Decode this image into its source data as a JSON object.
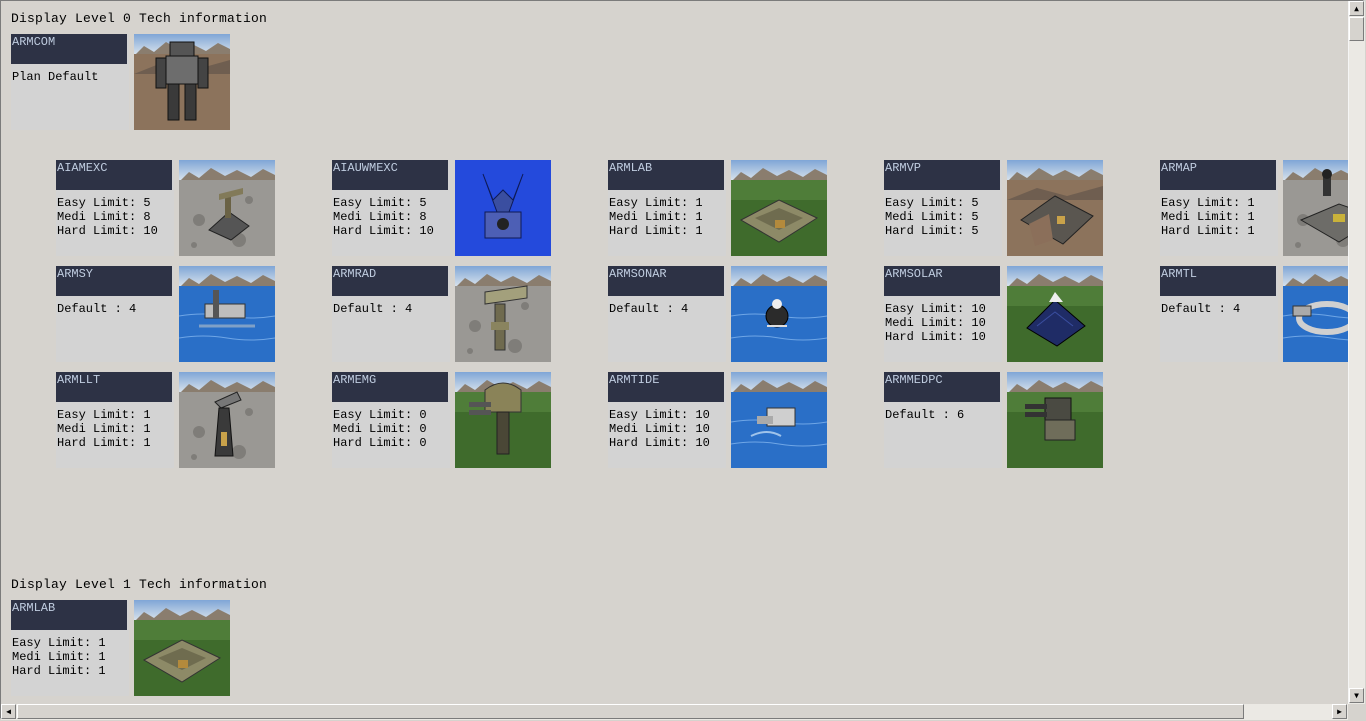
{
  "sections": [
    {
      "title": "Display Level 0 Tech information"
    },
    {
      "title": "Display Level 1 Tech information"
    }
  ],
  "units": [
    {
      "name": "ARMCOM",
      "lines": [
        "Plan Default"
      ],
      "image": "commander-robot"
    },
    {
      "name": "AIAMEXC",
      "lines": [
        "Easy Limit: 5",
        "Medi Limit: 8",
        "Hard Limit: 10"
      ],
      "image": "metal-extractor"
    },
    {
      "name": "AIAUWMEXC",
      "lines": [
        "Easy Limit: 5",
        "Medi Limit: 8",
        "Hard Limit: 10"
      ],
      "image": "underwater-extractor"
    },
    {
      "name": "ARMLAB",
      "lines": [
        "Easy Limit: 1",
        "Medi Limit: 1",
        "Hard Limit: 1"
      ],
      "image": "kbot-lab"
    },
    {
      "name": "ARMVP",
      "lines": [
        "Easy Limit: 5",
        "Medi Limit: 5",
        "Hard Limit: 5"
      ],
      "image": "vehicle-plant"
    },
    {
      "name": "ARMAP",
      "lines": [
        "Easy Limit: 1",
        "Medi Limit: 1",
        "Hard Limit: 1"
      ],
      "image": "air-plant"
    },
    {
      "name": "ARMSY",
      "lines": [
        "Default : 4"
      ],
      "image": "shipyard"
    },
    {
      "name": "ARMRAD",
      "lines": [
        "Default : 4"
      ],
      "image": "radar-tower"
    },
    {
      "name": "ARMSONAR",
      "lines": [
        "Default : 4"
      ],
      "image": "sonar-buoy"
    },
    {
      "name": "ARMSOLAR",
      "lines": [
        "Easy Limit: 10",
        "Medi Limit: 10",
        "Hard Limit: 10"
      ],
      "image": "solar-collector"
    },
    {
      "name": "ARMTL",
      "lines": [
        "Default : 4"
      ],
      "image": "torpedo-launcher"
    },
    {
      "name": "ARMLLT",
      "lines": [
        "Easy Limit: 1",
        "Medi Limit: 1",
        "Hard Limit: 1"
      ],
      "image": "light-laser-tower"
    },
    {
      "name": "ARMEMG",
      "lines": [
        "Easy Limit: 0",
        "Medi Limit: 0",
        "Hard Limit: 0"
      ],
      "image": "emg-turret"
    },
    {
      "name": "ARMTIDE",
      "lines": [
        "Easy Limit: 10",
        "Medi Limit: 10",
        "Hard Limit: 10"
      ],
      "image": "tidal-generator"
    },
    {
      "name": "ARMMEDPC",
      "lines": [
        "Default : 6"
      ],
      "image": "medium-plasma-cannon"
    },
    {
      "name": "ARMLAB",
      "lines": [
        "Easy Limit: 1",
        "Medi Limit: 1",
        "Hard Limit: 1"
      ],
      "image": "kbot-lab"
    }
  ],
  "colors": {
    "background": "#d6d3ce",
    "name_bar": "#2d3245",
    "name_text": "#c0cde0",
    "info_panel": "#d3d3d3"
  }
}
